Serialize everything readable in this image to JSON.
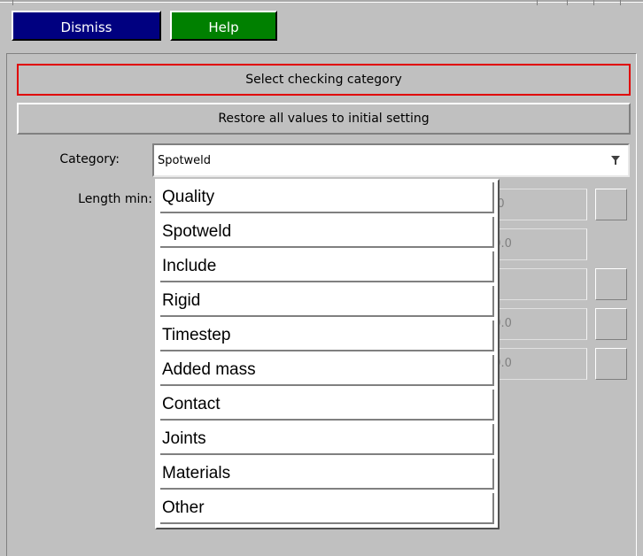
{
  "toolbar": {
    "dismiss_label": "Dismiss",
    "help_label": "Help",
    "dismiss_color": "#000080",
    "help_color": "#008000"
  },
  "actions": {
    "select_category_label": "Select checking category",
    "restore_label": "Restore all values to initial setting"
  },
  "category": {
    "label": "Category:",
    "value": "Spotweld",
    "arrow_icon": "filter-funnel-icon"
  },
  "fields": {
    "length_min_label": "Length min:",
    "values": [
      "5.0",
      "10.0",
      "",
      "10.0",
      "20.0"
    ]
  },
  "dropdown": {
    "options": [
      "Quality",
      "Spotweld",
      "Include",
      "Rigid",
      "Timestep",
      "Added mass",
      "Contact",
      "Joints",
      "Materials",
      "Other"
    ]
  }
}
